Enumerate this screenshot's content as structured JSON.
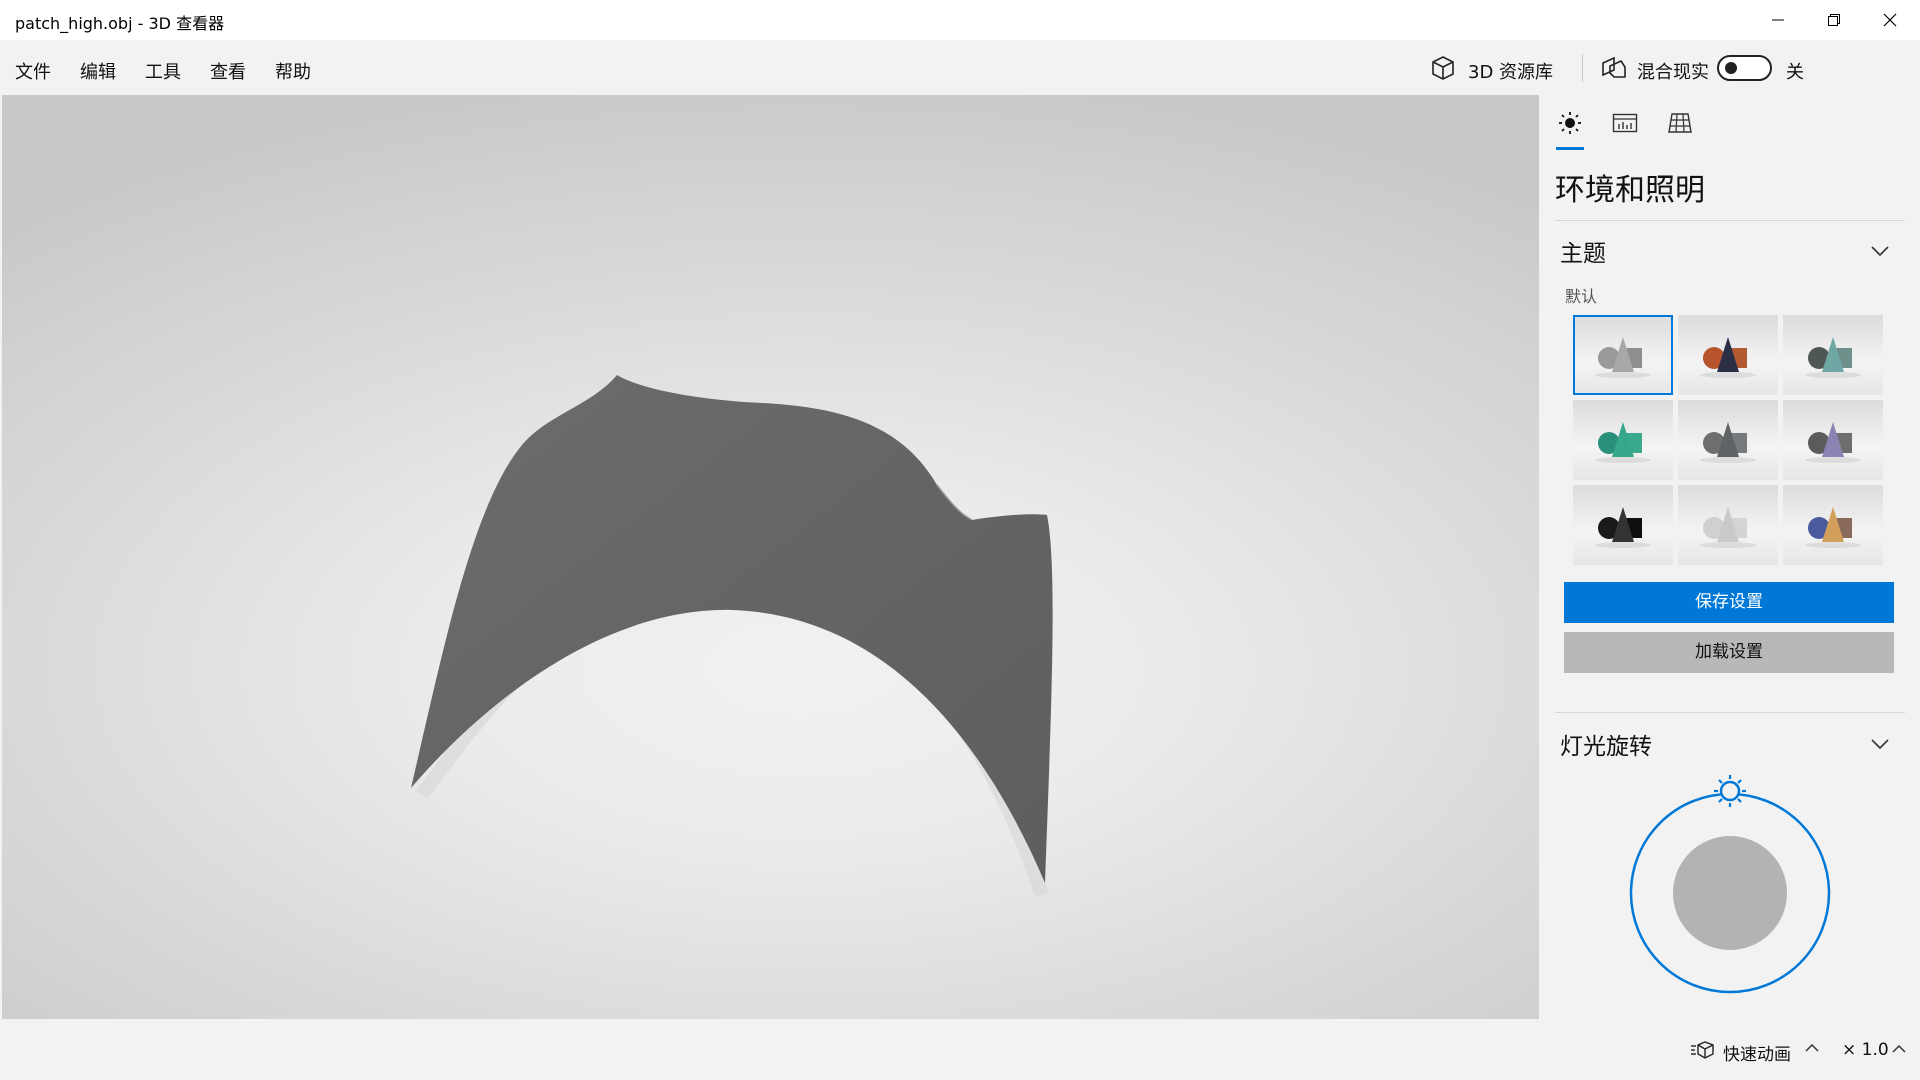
{
  "window": {
    "title": "patch_high.obj - 3D 查看器"
  },
  "menu": {
    "items": [
      "文件",
      "编辑",
      "工具",
      "查看",
      "帮助"
    ],
    "library_label": "3D 资源库",
    "mixed_reality_label": "混合现实",
    "mixed_reality_state": "关",
    "mixed_reality_on": false
  },
  "panel": {
    "tabs": [
      {
        "icon": "sun-icon",
        "active": true
      },
      {
        "icon": "stats-icon",
        "active": false
      },
      {
        "icon": "grid-icon",
        "active": false
      }
    ],
    "title": "环境和照明",
    "theme": {
      "title": "主题",
      "selected_name": "默认",
      "thumbnails": [
        {
          "colors": [
            "#9a9a9a",
            "#a8a8a8",
            "#8e8e8e"
          ],
          "selected": true
        },
        {
          "colors": [
            "#b8542c",
            "#2a2f45",
            "#b45a33"
          ],
          "selected": false
        },
        {
          "colors": [
            "#4f5656",
            "#6fa7a4",
            "#6e8f8a"
          ],
          "selected": false
        },
        {
          "colors": [
            "#2a8f7a",
            "#36a88a",
            "#3aa98c"
          ],
          "selected": false
        },
        {
          "colors": [
            "#6e6e6e",
            "#5f6366",
            "#777a7c"
          ],
          "selected": false
        },
        {
          "colors": [
            "#5b5b5b",
            "#8a84b2",
            "#6e6e6e"
          ],
          "selected": false
        },
        {
          "colors": [
            "#1a1a1a",
            "#333333",
            "#0f0f0f"
          ],
          "selected": false
        },
        {
          "colors": [
            "#d0d0d0",
            "#c9c9c9",
            "#d4d4d4"
          ],
          "selected": false
        },
        {
          "colors": [
            "#4b5a9e",
            "#d2a05a",
            "#8a6a5a"
          ],
          "selected": false
        }
      ],
      "save_label": "保存设置",
      "load_label": "加载设置"
    },
    "light": {
      "title": "灯光旋转"
    }
  },
  "status": {
    "animation_label": "快速动画",
    "speed_label": "× 1.0"
  },
  "colors": {
    "accent": "#0078d7",
    "model": "#676767"
  }
}
